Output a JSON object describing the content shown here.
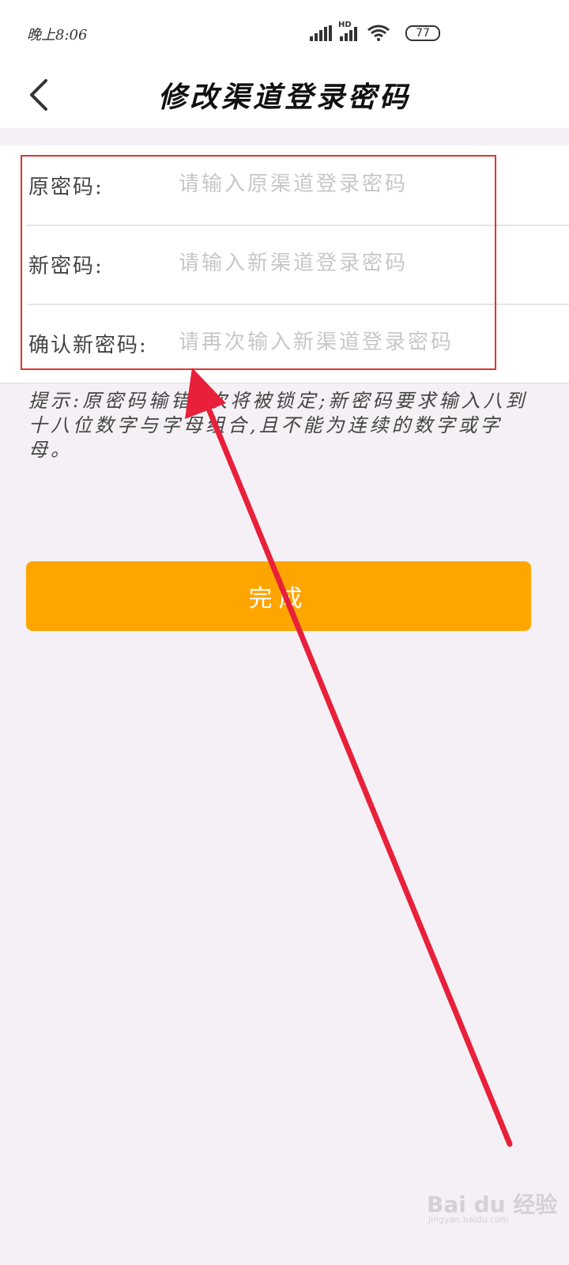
{
  "status_bar": {
    "time": "晚上8:06",
    "network": "HD",
    "battery": "77"
  },
  "header": {
    "title": "修改渠道登录密码",
    "back_icon": "chevron-left-icon"
  },
  "form": {
    "rows": [
      {
        "label": "原密码:",
        "placeholder": "请输入原渠道登录密码",
        "value": ""
      },
      {
        "label": "新密码:",
        "placeholder": "请输入新渠道登录密码",
        "value": ""
      },
      {
        "label": "确认新密码:",
        "placeholder": "请再次输入新渠道登录密码",
        "value": ""
      }
    ]
  },
  "hint": "提示:原密码输错5次将被锁定;新密码要求输入八到十八位数字与字母组合,且不能为连续的数字或字母。",
  "done_button": "完成",
  "colors": {
    "accent": "#ffa500",
    "annotation": "#e03333"
  },
  "watermark": {
    "brand": "Bai du 经验",
    "url": "jingyan.baidu.com"
  }
}
